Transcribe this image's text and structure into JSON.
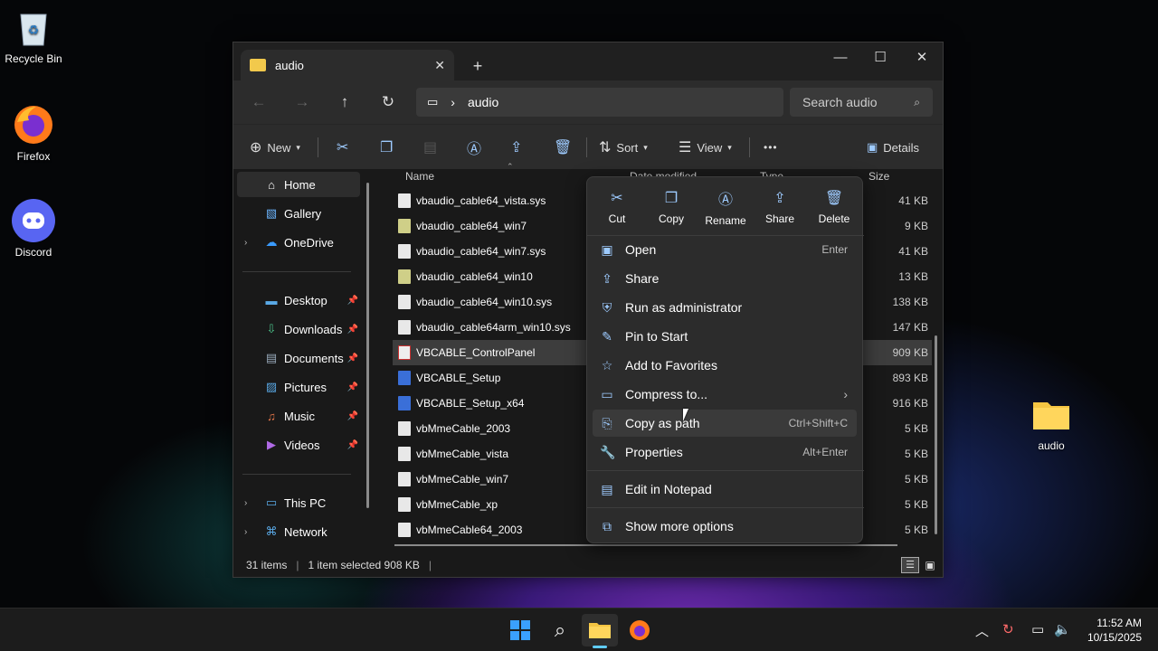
{
  "desktop": {
    "icons": [
      {
        "label": "Recycle Bin",
        "icon": "recycle-bin-icon"
      },
      {
        "label": "Firefox",
        "icon": "firefox-icon"
      },
      {
        "label": "Discord",
        "icon": "discord-icon"
      },
      {
        "label": "audio",
        "icon": "folder-icon"
      }
    ]
  },
  "window": {
    "tab_title": "audio",
    "new_tab": "+",
    "controls": {
      "minimize": "—",
      "maximize": "☐",
      "close": "✕"
    }
  },
  "address": {
    "path": "audio",
    "search_placeholder": "Search audio"
  },
  "toolbar": {
    "new": "New",
    "sort": "Sort",
    "view": "View",
    "more": "•••",
    "details": "Details"
  },
  "nav": {
    "home": "Home",
    "gallery": "Gallery",
    "onedrive": "OneDrive",
    "desktop": "Desktop",
    "downloads": "Downloads",
    "documents": "Documents",
    "pictures": "Pictures",
    "music": "Music",
    "videos": "Videos",
    "this_pc": "This PC",
    "network": "Network"
  },
  "columns": {
    "name": "Name",
    "date": "Date modified",
    "type": "Type",
    "size": "Size"
  },
  "files": [
    {
      "name": "vbaudio_cable64_vista.sys",
      "size": "41 KB",
      "kind": "sys"
    },
    {
      "name": "vbaudio_cable64_win7",
      "size": "9 KB",
      "kind": "dll"
    },
    {
      "name": "vbaudio_cable64_win7.sys",
      "size": "41 KB",
      "kind": "sys"
    },
    {
      "name": "vbaudio_cable64_win10",
      "size": "13 KB",
      "kind": "dll"
    },
    {
      "name": "vbaudio_cable64_win10.sys",
      "size": "138 KB",
      "kind": "sys"
    },
    {
      "name": "vbaudio_cable64arm_win10.sys",
      "size": "147 KB",
      "kind": "sys"
    },
    {
      "name": "VBCABLE_ControlPanel",
      "size": "909 KB",
      "kind": "cp"
    },
    {
      "name": "VBCABLE_Setup",
      "size": "893 KB",
      "kind": "exe"
    },
    {
      "name": "VBCABLE_Setup_x64",
      "size": "916 KB",
      "kind": "exe"
    },
    {
      "name": "vbMmeCable_2003",
      "size": "5 KB",
      "kind": "sys"
    },
    {
      "name": "vbMmeCable_vista",
      "size": "5 KB",
      "kind": "sys"
    },
    {
      "name": "vbMmeCable_win7",
      "size": "5 KB",
      "kind": "sys"
    },
    {
      "name": "vbMmeCable_xp",
      "size": "5 KB",
      "kind": "sys"
    },
    {
      "name": "vbMmeCable64_2003",
      "size": "5 KB",
      "kind": "sys"
    }
  ],
  "status": {
    "count": "31 items",
    "selection": "1 item selected  908 KB"
  },
  "context_menu": {
    "quick": [
      {
        "label": "Cut",
        "icon": "cut-icon"
      },
      {
        "label": "Copy",
        "icon": "copy-icon"
      },
      {
        "label": "Rename",
        "icon": "rename-icon"
      },
      {
        "label": "Share",
        "icon": "share-icon"
      },
      {
        "label": "Delete",
        "icon": "delete-icon"
      }
    ],
    "items": [
      {
        "label": "Open",
        "shortcut": "Enter"
      },
      {
        "label": "Share",
        "shortcut": ""
      },
      {
        "label": "Run as administrator",
        "shortcut": ""
      },
      {
        "label": "Pin to Start",
        "shortcut": ""
      },
      {
        "label": "Add to Favorites",
        "shortcut": ""
      },
      {
        "label": "Compress to...",
        "shortcut": ""
      },
      {
        "label": "Copy as path",
        "shortcut": "Ctrl+Shift+C"
      },
      {
        "label": "Properties",
        "shortcut": "Alt+Enter"
      },
      {
        "label": "Edit in Notepad",
        "shortcut": ""
      },
      {
        "label": "Show more options",
        "shortcut": ""
      }
    ]
  },
  "taskbar": {
    "time": "11:52 AM",
    "date": "10/15/2025"
  },
  "colors": {
    "accent": "#60cdff",
    "selected_row": "#3d3d3d"
  }
}
